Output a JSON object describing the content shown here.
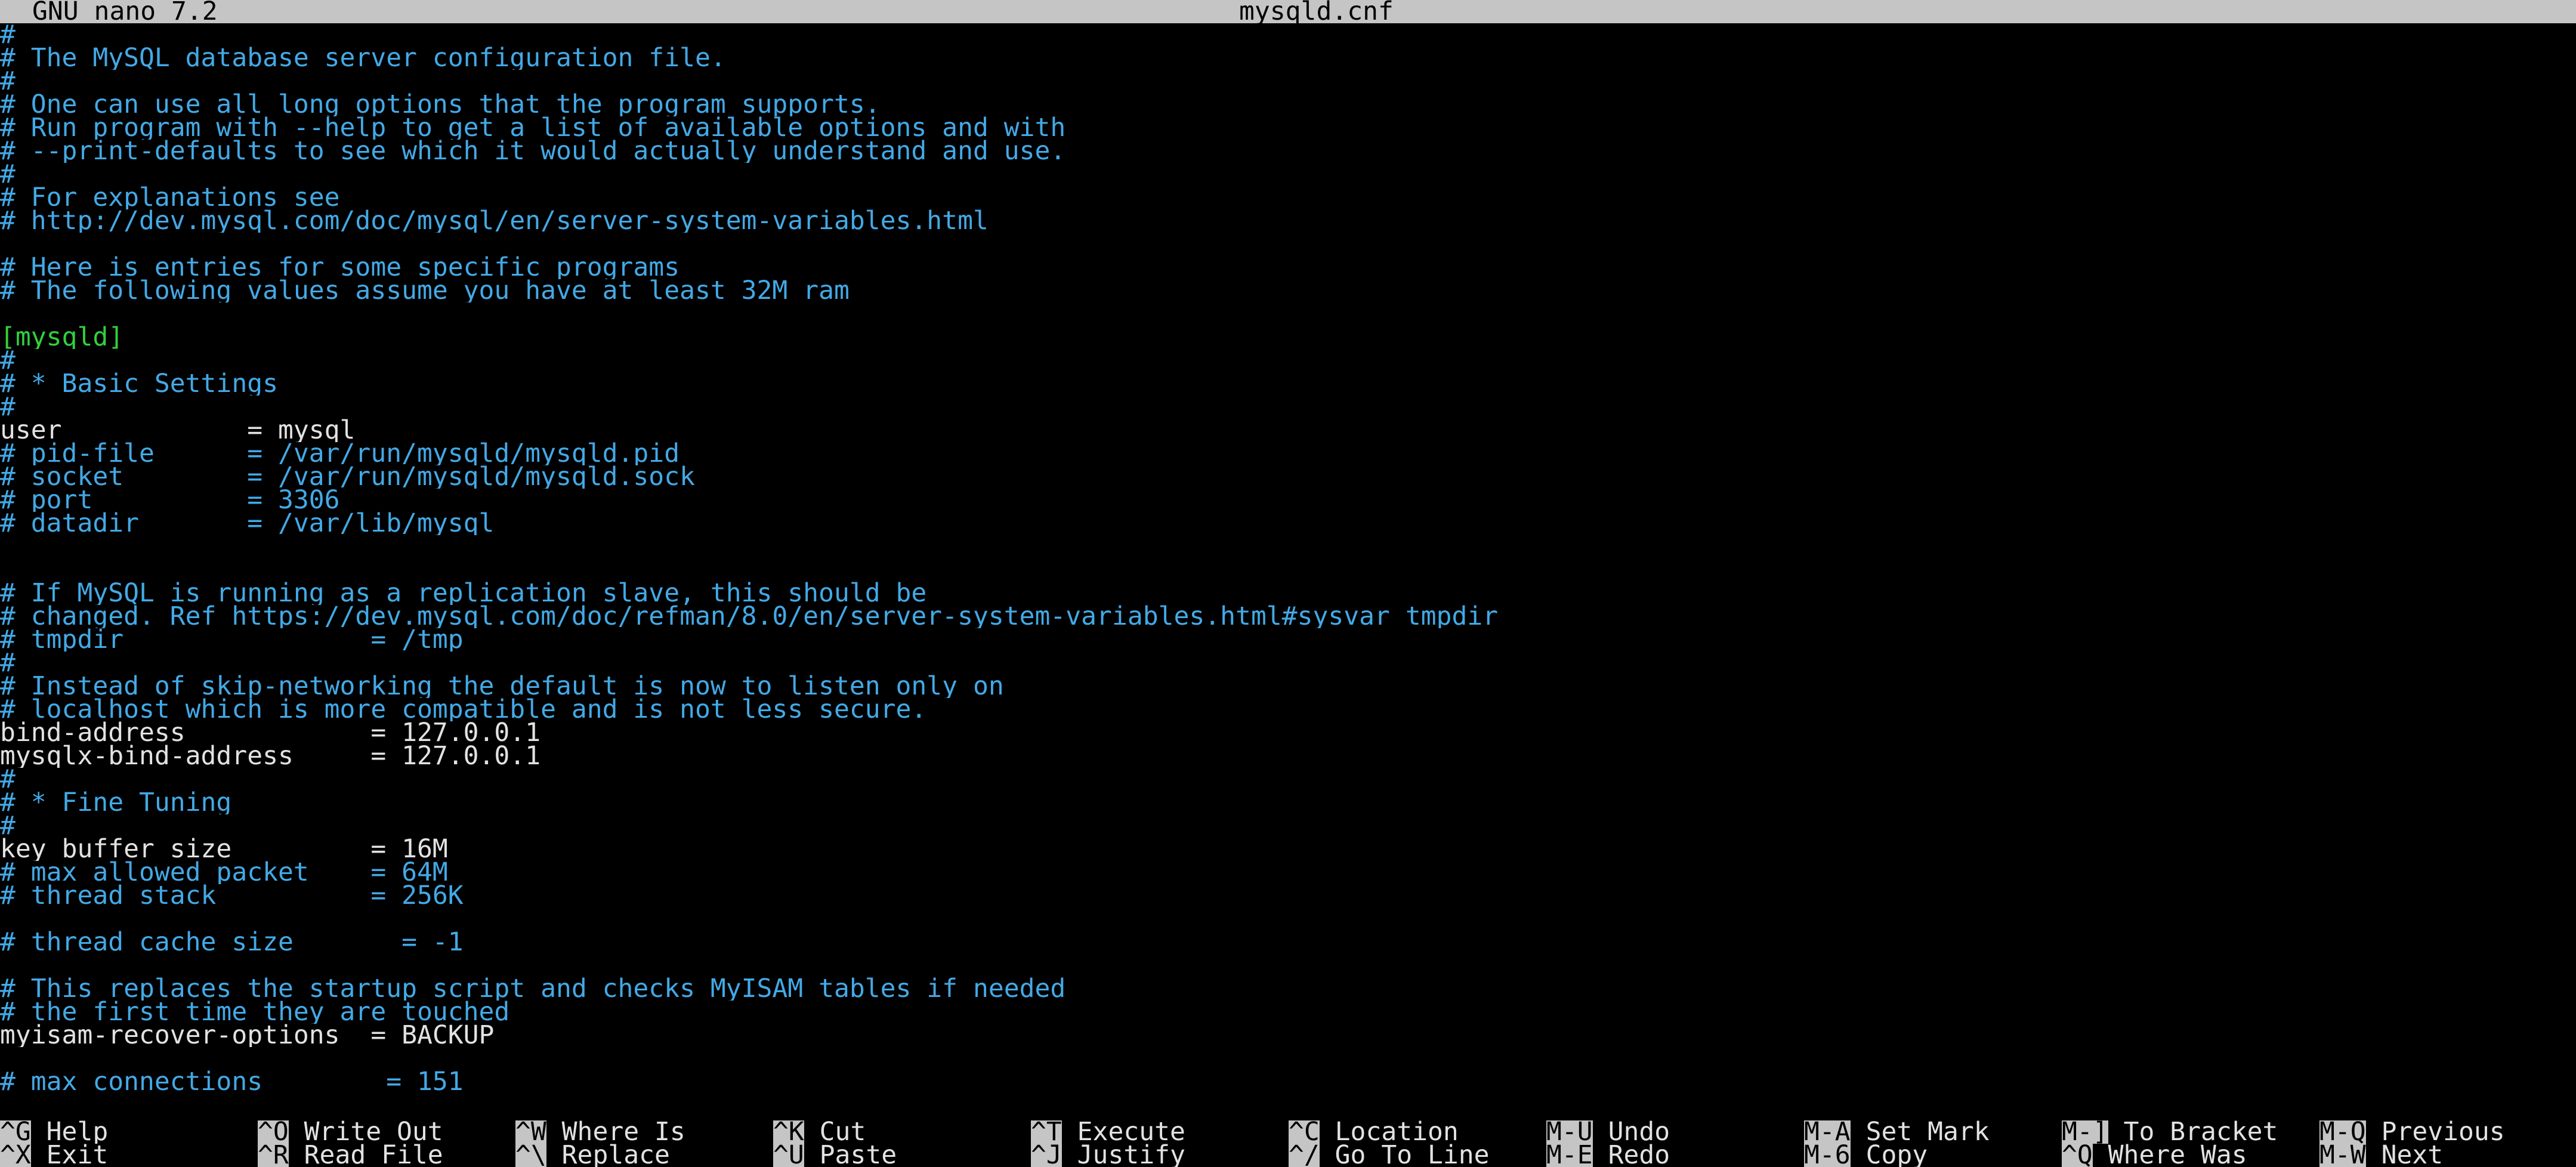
{
  "titlebar": {
    "app_version": "GNU nano 7.2",
    "filename": "mysqld.cnf"
  },
  "colors": {
    "background": "#000000",
    "comment": "#43a9e6",
    "section": "#31d13b",
    "plain_text": "#e2e2e2",
    "bar": "#c5c5c5"
  },
  "lines": [
    {
      "text": "#",
      "type": "comment"
    },
    {
      "text": "# The MySQL database server configuration file.",
      "type": "comment"
    },
    {
      "text": "#",
      "type": "comment"
    },
    {
      "text": "# One can use all long options that the program supports.",
      "type": "comment"
    },
    {
      "text": "# Run program with --help to get a list of available options and with",
      "type": "comment"
    },
    {
      "text": "# --print-defaults to see which it would actually understand and use.",
      "type": "comment"
    },
    {
      "text": "#",
      "type": "comment"
    },
    {
      "text": "# For explanations see",
      "type": "comment"
    },
    {
      "text": "# http://dev.mysql.com/doc/mysql/en/server-system-variables.html",
      "type": "comment"
    },
    {
      "text": "",
      "type": "plain"
    },
    {
      "text": "# Here is entries for some specific programs",
      "type": "comment"
    },
    {
      "text": "# The following values assume you have at least 32M ram",
      "type": "comment"
    },
    {
      "text": "",
      "type": "plain"
    },
    {
      "text": "[mysqld]",
      "type": "section"
    },
    {
      "text": "#",
      "type": "comment"
    },
    {
      "text": "# * Basic Settings",
      "type": "comment"
    },
    {
      "text": "#",
      "type": "comment"
    },
    {
      "text": "user            = mysql",
      "type": "plain"
    },
    {
      "text": "# pid-file      = /var/run/mysqld/mysqld.pid",
      "type": "comment"
    },
    {
      "text": "# socket        = /var/run/mysqld/mysqld.sock",
      "type": "comment"
    },
    {
      "text": "# port          = 3306",
      "type": "comment"
    },
    {
      "text": "# datadir       = /var/lib/mysql",
      "type": "comment"
    },
    {
      "text": "",
      "type": "plain"
    },
    {
      "text": "",
      "type": "plain"
    },
    {
      "text": "# If MySQL is running as a replication slave, this should be",
      "type": "comment"
    },
    {
      "text": "# changed. Ref https://dev.mysql.com/doc/refman/8.0/en/server-system-variables.html#sysvar_tmpdir",
      "type": "comment"
    },
    {
      "text": "# tmpdir                = /tmp",
      "type": "comment"
    },
    {
      "text": "#",
      "type": "comment"
    },
    {
      "text": "# Instead of skip-networking the default is now to listen only on",
      "type": "comment"
    },
    {
      "text": "# localhost which is more compatible and is not less secure.",
      "type": "comment"
    },
    {
      "text": "bind-address            = 127.0.0.1",
      "type": "plain"
    },
    {
      "text": "mysqlx-bind-address     = 127.0.0.1",
      "type": "plain"
    },
    {
      "text": "#",
      "type": "comment"
    },
    {
      "text": "# * Fine Tuning",
      "type": "comment"
    },
    {
      "text": "#",
      "type": "comment"
    },
    {
      "text": "key_buffer_size         = 16M",
      "type": "plain"
    },
    {
      "text": "# max_allowed_packet    = 64M",
      "type": "comment"
    },
    {
      "text": "# thread_stack          = 256K",
      "type": "comment"
    },
    {
      "text": "",
      "type": "plain"
    },
    {
      "text": "# thread_cache_size       = -1",
      "type": "comment"
    },
    {
      "text": "",
      "type": "plain"
    },
    {
      "text": "# This replaces the startup script and checks MyISAM tables if needed",
      "type": "comment"
    },
    {
      "text": "# the first time they are touched",
      "type": "comment"
    },
    {
      "text": "myisam-recover-options  = BACKUP",
      "type": "plain"
    },
    {
      "text": "",
      "type": "plain"
    },
    {
      "text": "# max_connections        = 151",
      "type": "comment"
    }
  ],
  "shortcuts": {
    "row1": [
      {
        "key": "^G",
        "label": "Help"
      },
      {
        "key": "^O",
        "label": "Write Out"
      },
      {
        "key": "^W",
        "label": "Where Is"
      },
      {
        "key": "^K",
        "label": "Cut"
      },
      {
        "key": "^T",
        "label": "Execute"
      },
      {
        "key": "^C",
        "label": "Location"
      },
      {
        "key": "M-U",
        "label": "Undo"
      },
      {
        "key": "M-A",
        "label": "Set Mark"
      },
      {
        "key": "M-]",
        "label": "To Bracket"
      },
      {
        "key": "M-Q",
        "label": "Previous"
      }
    ],
    "row2": [
      {
        "key": "^X",
        "label": "Exit"
      },
      {
        "key": "^R",
        "label": "Read File"
      },
      {
        "key": "^\\",
        "label": "Replace"
      },
      {
        "key": "^U",
        "label": "Paste"
      },
      {
        "key": "^J",
        "label": "Justify"
      },
      {
        "key": "^/",
        "label": "Go To Line"
      },
      {
        "key": "M-E",
        "label": "Redo"
      },
      {
        "key": "M-6",
        "label": "Copy"
      },
      {
        "key": "^Q",
        "label": "Where Was"
      },
      {
        "key": "M-W",
        "label": "Next"
      }
    ]
  }
}
